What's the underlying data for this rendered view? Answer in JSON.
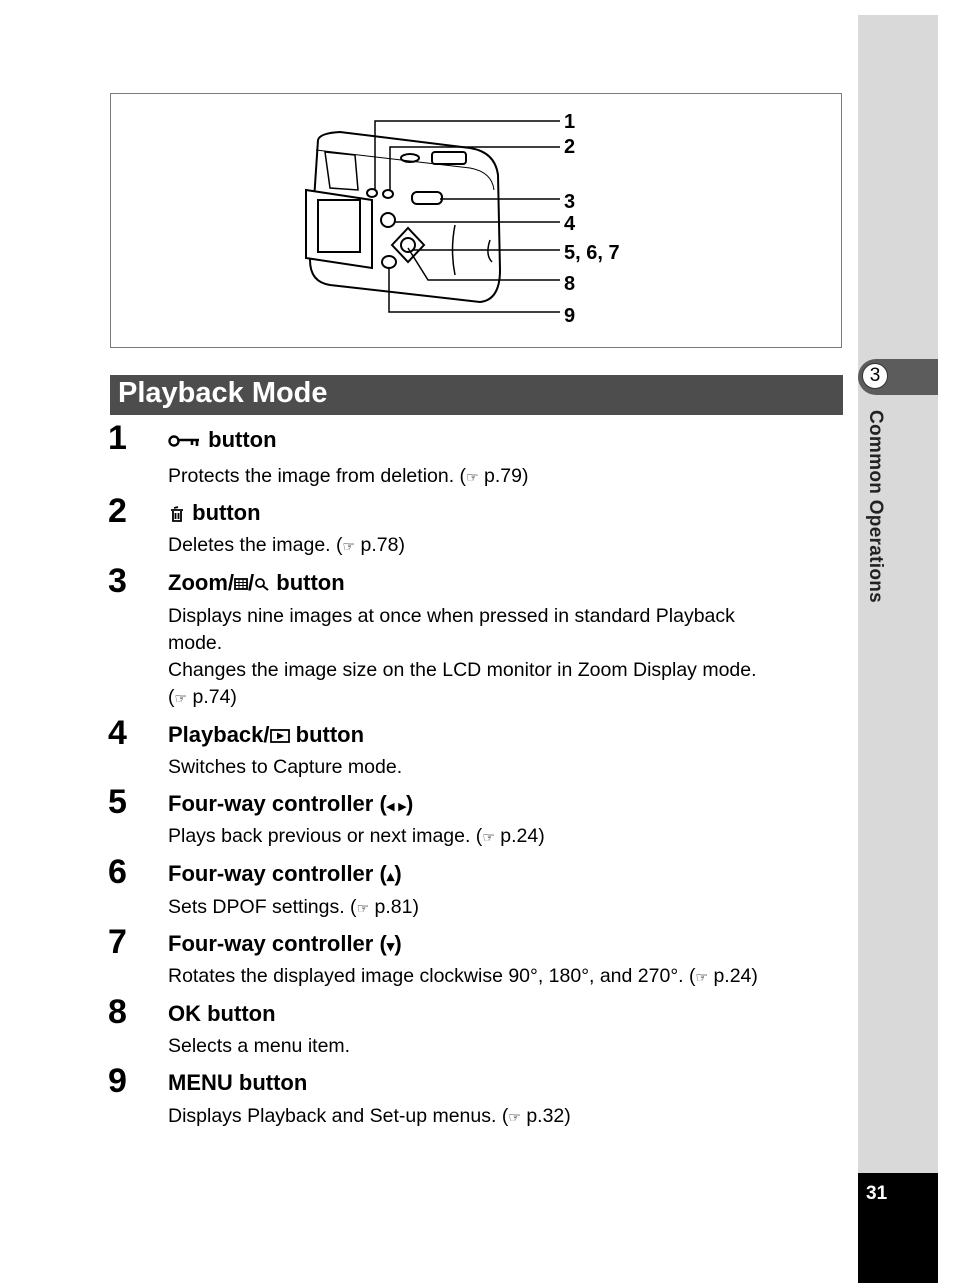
{
  "sidebar": {
    "chapter_number": "3",
    "chapter_title": "Common Operations",
    "page_number": "31"
  },
  "figure": {
    "callouts": [
      "1",
      "2",
      "3",
      "4",
      "5, 6, 7",
      "8",
      "9"
    ]
  },
  "section": {
    "title": "Playback Mode"
  },
  "ref_glyph": "☞",
  "items": [
    {
      "num": "1",
      "icon": "key-protect-icon",
      "title": "button",
      "lines": [
        "Protects the image from deletion. (",
        "p.79)"
      ]
    },
    {
      "num": "2",
      "icon": "trash-icon",
      "title": "button",
      "lines": [
        "Deletes the image. (",
        "p.78)"
      ]
    },
    {
      "num": "3",
      "title_pre": "Zoom/",
      "icon": "grid-icon",
      "icon2": "magnifier-icon",
      "title": "button",
      "desc": [
        "Displays nine images at once when pressed in standard Playback",
        "mode.",
        "Changes the image size on the LCD monitor in Zoom Display mode."
      ],
      "ref_open": "(",
      "ref_page": "p.74)"
    },
    {
      "num": "4",
      "title_pre": "Playback/",
      "icon": "play-icon",
      "title": "button",
      "desc": "Switches to Capture mode."
    },
    {
      "num": "5",
      "title": "Four-way controller (",
      "arrows": "◂ ▸",
      "title_close": ")",
      "lines": [
        "Plays back previous or next image. (",
        "p.24)"
      ]
    },
    {
      "num": "6",
      "title": "Four-way controller (",
      "arrows": "▴",
      "title_close": ")",
      "lines": [
        "Sets DPOF settings. (",
        "p.81)"
      ]
    },
    {
      "num": "7",
      "title": "Four-way controller (",
      "arrows": "▾",
      "title_close": ")",
      "lines": [
        "Rotates the displayed image clockwise 90°, 180°, and 270°. (",
        "p.24)"
      ]
    },
    {
      "num": "8",
      "title": "OK button",
      "desc": "Selects a menu item."
    },
    {
      "num": "9",
      "title": "MENU button",
      "lines": [
        "Displays Playback and Set-up menus. (",
        "p.32)"
      ]
    }
  ]
}
